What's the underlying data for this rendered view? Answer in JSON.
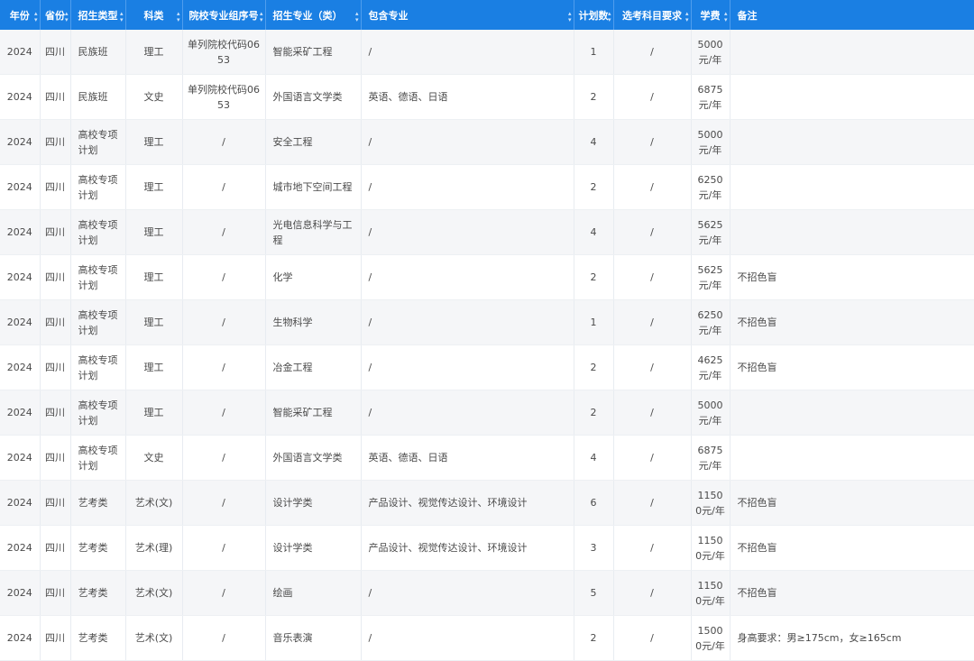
{
  "table": {
    "columns": [
      {
        "key": "year",
        "label": "年份"
      },
      {
        "key": "province",
        "label": "省份"
      },
      {
        "key": "type",
        "label": "招生类型"
      },
      {
        "key": "subject",
        "label": "科类"
      },
      {
        "key": "group",
        "label": "院校专业组序号"
      },
      {
        "key": "major",
        "label": "招生专业（类）"
      },
      {
        "key": "includes",
        "label": "包含专业"
      },
      {
        "key": "plan",
        "label": "计划数"
      },
      {
        "key": "requirement",
        "label": "选考科目要求"
      },
      {
        "key": "tuition",
        "label": "学费"
      },
      {
        "key": "notes",
        "label": "备注"
      }
    ],
    "rows": [
      {
        "year": "2024",
        "province": "四川",
        "type": "民族班",
        "subject": "理工",
        "group": "单列院校代码0653",
        "major": "智能采矿工程",
        "includes": "/",
        "plan": "1",
        "requirement": "/",
        "tuition": "5000元/年",
        "notes": ""
      },
      {
        "year": "2024",
        "province": "四川",
        "type": "民族班",
        "subject": "文史",
        "group": "单列院校代码0653",
        "major": "外国语言文学类",
        "includes": "英语、德语、日语",
        "plan": "2",
        "requirement": "/",
        "tuition": "6875元/年",
        "notes": ""
      },
      {
        "year": "2024",
        "province": "四川",
        "type": "高校专项计划",
        "subject": "理工",
        "group": "/",
        "major": "安全工程",
        "includes": "/",
        "plan": "4",
        "requirement": "/",
        "tuition": "5000元/年",
        "notes": ""
      },
      {
        "year": "2024",
        "province": "四川",
        "type": "高校专项计划",
        "subject": "理工",
        "group": "/",
        "major": "城市地下空间工程",
        "includes": "/",
        "plan": "2",
        "requirement": "/",
        "tuition": "6250元/年",
        "notes": ""
      },
      {
        "year": "2024",
        "province": "四川",
        "type": "高校专项计划",
        "subject": "理工",
        "group": "/",
        "major": "光电信息科学与工程",
        "includes": "/",
        "plan": "4",
        "requirement": "/",
        "tuition": "5625元/年",
        "notes": ""
      },
      {
        "year": "2024",
        "province": "四川",
        "type": "高校专项计划",
        "subject": "理工",
        "group": "/",
        "major": "化学",
        "includes": "/",
        "plan": "2",
        "requirement": "/",
        "tuition": "5625元/年",
        "notes": "不招色盲"
      },
      {
        "year": "2024",
        "province": "四川",
        "type": "高校专项计划",
        "subject": "理工",
        "group": "/",
        "major": "生物科学",
        "includes": "/",
        "plan": "1",
        "requirement": "/",
        "tuition": "6250元/年",
        "notes": "不招色盲"
      },
      {
        "year": "2024",
        "province": "四川",
        "type": "高校专项计划",
        "subject": "理工",
        "group": "/",
        "major": "冶金工程",
        "includes": "/",
        "plan": "2",
        "requirement": "/",
        "tuition": "4625元/年",
        "notes": "不招色盲"
      },
      {
        "year": "2024",
        "province": "四川",
        "type": "高校专项计划",
        "subject": "理工",
        "group": "/",
        "major": "智能采矿工程",
        "includes": "/",
        "plan": "2",
        "requirement": "/",
        "tuition": "5000元/年",
        "notes": ""
      },
      {
        "year": "2024",
        "province": "四川",
        "type": "高校专项计划",
        "subject": "文史",
        "group": "/",
        "major": "外国语言文学类",
        "includes": "英语、德语、日语",
        "plan": "4",
        "requirement": "/",
        "tuition": "6875元/年",
        "notes": ""
      },
      {
        "year": "2024",
        "province": "四川",
        "type": "艺考类",
        "subject": "艺术(文)",
        "group": "/",
        "major": "设计学类",
        "includes": "产品设计、视觉传达设计、环境设计",
        "plan": "6",
        "requirement": "/",
        "tuition": "11500元/年",
        "notes": "不招色盲"
      },
      {
        "year": "2024",
        "province": "四川",
        "type": "艺考类",
        "subject": "艺术(理)",
        "group": "/",
        "major": "设计学类",
        "includes": "产品设计、视觉传达设计、环境设计",
        "plan": "3",
        "requirement": "/",
        "tuition": "11500元/年",
        "notes": "不招色盲"
      },
      {
        "year": "2024",
        "province": "四川",
        "type": "艺考类",
        "subject": "艺术(文)",
        "group": "/",
        "major": "绘画",
        "includes": "/",
        "plan": "5",
        "requirement": "/",
        "tuition": "11500元/年",
        "notes": "不招色盲"
      },
      {
        "year": "2024",
        "province": "四川",
        "type": "艺考类",
        "subject": "艺术(文)",
        "group": "/",
        "major": "音乐表演",
        "includes": "/",
        "plan": "2",
        "requirement": "/",
        "tuition": "15000元/年",
        "notes": "身高要求：男≥175cm，女≥165cm"
      }
    ]
  },
  "icons": {
    "sort": "sort-icon"
  },
  "colors": {
    "header_bg": "#1a7fe3",
    "header_text": "#ffffff",
    "stripe": "#f5f6f8"
  }
}
